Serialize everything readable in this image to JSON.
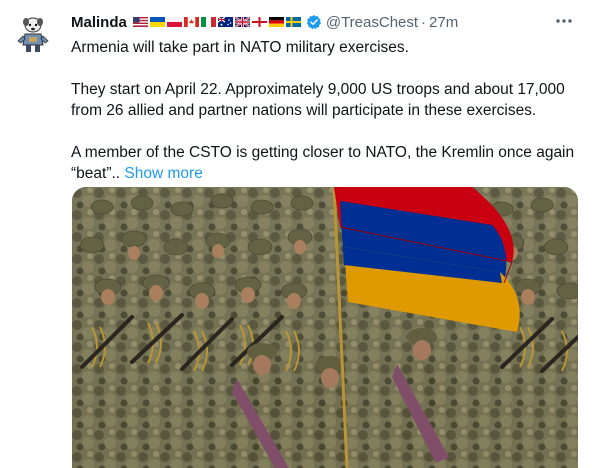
{
  "tweet": {
    "display_name": "Malinda",
    "handle": "@TreasChest",
    "separator": "·",
    "time": "27m",
    "flags": [
      "us-flag",
      "ukraine-flag",
      "poland-flag",
      "canada-flag",
      "italy-flag",
      "australia-flag",
      "uk-flag",
      "england-flag",
      "germany-flag",
      "sweden-flag"
    ],
    "paragraphs": [
      "Armenia will take part in NATO military exercises.",
      "They start on April 22. Approximately 9,000 US troops and about 17,000 from 26 allied and partner nations will participate in these exercises.",
      "A member of the CSTO is getting closer to NATO, the Kremlin once again “beat”.."
    ],
    "show_more": "Show more",
    "media_alt": "Armenian soldiers marching in camouflage uniforms behind the Armenian tricolor flag"
  },
  "colors": {
    "link": "#1d9bf0",
    "verified": "#1d9bf0",
    "secondary_text": "#536471",
    "flag_red": "#d90012",
    "flag_blue": "#0033a0",
    "flag_orange": "#f2a800"
  }
}
